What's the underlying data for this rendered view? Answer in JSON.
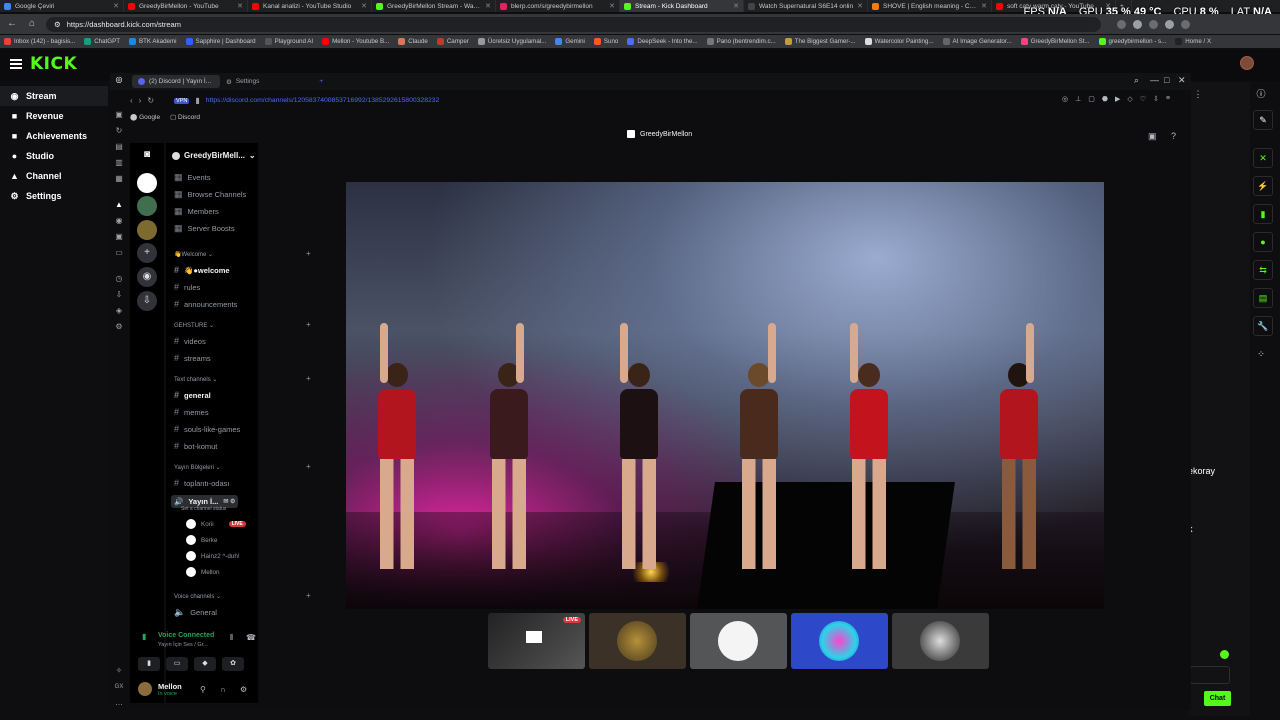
{
  "browser": {
    "tabs": [
      {
        "title": "Google Çeviri",
        "color": "#4285f4"
      },
      {
        "title": "GreedyBirMellon - YouTube",
        "color": "#ff0000"
      },
      {
        "title": "Kanal analizi - YouTube Studio",
        "color": "#ff0000"
      },
      {
        "title": "GreedyBirMellon Stream - Watch",
        "color": "#53fc18"
      },
      {
        "title": "blerp.com/s/greedybirmellon",
        "color": "#e0245e"
      },
      {
        "title": "Stream - Kick Dashboard",
        "color": "#53fc18",
        "active": true
      },
      {
        "title": "Watch Supernatural S6E14 onlin",
        "color": "#444"
      },
      {
        "title": "SHOVE | English meaning - Camb",
        "color": "#ff7a00"
      },
      {
        "title": "soft caty warm caty - YouTube",
        "color": "#ff0000"
      }
    ],
    "url": "https://dashboard.kick.com/stream",
    "bookmarks": [
      {
        "label": "Inbox (142) - bagisis...",
        "color": "#ea4335"
      },
      {
        "label": "ChatGPT",
        "color": "#10a37f"
      },
      {
        "label": "BTK Akademi",
        "color": "#1e88e5"
      },
      {
        "label": "Sapphire | Dashboard",
        "color": "#2962ff"
      },
      {
        "label": "Playground AI",
        "color": "#555"
      },
      {
        "label": "Mellon - Youtube B...",
        "color": "#ff0000"
      },
      {
        "label": "Claude",
        "color": "#d97757"
      },
      {
        "label": "Camper",
        "color": "#c0392b"
      },
      {
        "label": "Ücretsiz Uygulamal...",
        "color": "#999"
      },
      {
        "label": "Gemini",
        "color": "#4285f4"
      },
      {
        "label": "Suno",
        "color": "#ff5722"
      },
      {
        "label": "DeepSeek - Into the...",
        "color": "#4d6bfe"
      },
      {
        "label": "Pano (bentrendim.c...",
        "color": "#777"
      },
      {
        "label": "The Biggest Gamer-...",
        "color": "#c49a45"
      },
      {
        "label": "Watercolor Painting...",
        "color": "#ddd"
      },
      {
        "label": "AI Image Generator...",
        "color": "#666"
      },
      {
        "label": "GreedyBirMellon St...",
        "color": "#ff4081"
      },
      {
        "label": "greedybirmellon - s...",
        "color": "#53fc18"
      },
      {
        "label": "Home / X",
        "color": "#222"
      }
    ],
    "overlay": {
      "fps_label": "FPS",
      "fps_value": "N/A",
      "gpu_label": "GPU",
      "gpu_value": "35 % 49 °C",
      "cpu_label": "CPU",
      "cpu_value": "8 %",
      "lat_label": "LAT",
      "lat_value": "N/A"
    }
  },
  "kick": {
    "logo": "KICK",
    "nav": [
      {
        "label": "Stream",
        "icon": "broadcast-icon",
        "glyph": "((•))",
        "active": true
      },
      {
        "label": "Revenue",
        "icon": "money-icon",
        "glyph": "■"
      },
      {
        "label": "Achievements",
        "icon": "trophy-icon",
        "glyph": "■"
      },
      {
        "label": "Studio",
        "icon": "studio-icon",
        "glyph": "●"
      },
      {
        "label": "Channel",
        "icon": "channel-icon",
        "glyph": "▲"
      },
      {
        "label": "Settings",
        "icon": "gear-icon",
        "glyph": "⚙"
      }
    ],
    "side_texts": [
      "ekoray",
      "k"
    ],
    "chat_button": "Chat"
  },
  "discord_window": {
    "tabs": [
      {
        "label": "(2) Discord | Yayın İ..."
      },
      {
        "label": "Settings"
      }
    ],
    "url": "https://discord.com/channels/1205837400853716992/1385292615800328232",
    "vpn": "VPN",
    "bookmarks": [
      "Google",
      "Discord"
    ],
    "server_name": "GreedyBirMell...",
    "menu": [
      "Events",
      "Browse Channels",
      "Members",
      "Server Boosts"
    ],
    "categories": [
      {
        "name": "👋Welcome ⌄",
        "channels": [
          "👋●welcome",
          "rules",
          "announcements"
        ]
      },
      {
        "name": "GEHSTURE ⌄",
        "channels": [
          "videos",
          "streams"
        ]
      },
      {
        "name": "Text channels ⌄",
        "channels": [
          "general",
          "memes",
          "souls-like-games",
          "bot-komut"
        ]
      },
      {
        "name": "Yayın Bölgeleri ⌄",
        "channels": [
          "toplantı-odası"
        ]
      }
    ],
    "voice_channel": {
      "name": "Yayın İ...",
      "status": "Set a channel status"
    },
    "voice_users": [
      {
        "name": "Korii",
        "live": "LIVE"
      },
      {
        "name": "Berke"
      },
      {
        "name": "Hainz2 ^-duh!"
      },
      {
        "name": "Mellon"
      }
    ],
    "voice_cat": "Voice channels ⌄",
    "voice_general": "General",
    "voice_connected": {
      "title": "Voice Connected",
      "sub": "Yayın İçin Ses / Gr..."
    },
    "user": {
      "name": "Mellon",
      "status": "In voice"
    },
    "stage_title": "GreedyBirMellon",
    "thumb_live": "LIVE"
  },
  "colors": {
    "kick_green": "#53fc18",
    "discord_blurple": "#5865f2",
    "live_red": "#da373c",
    "voice_green": "#23a55a"
  }
}
